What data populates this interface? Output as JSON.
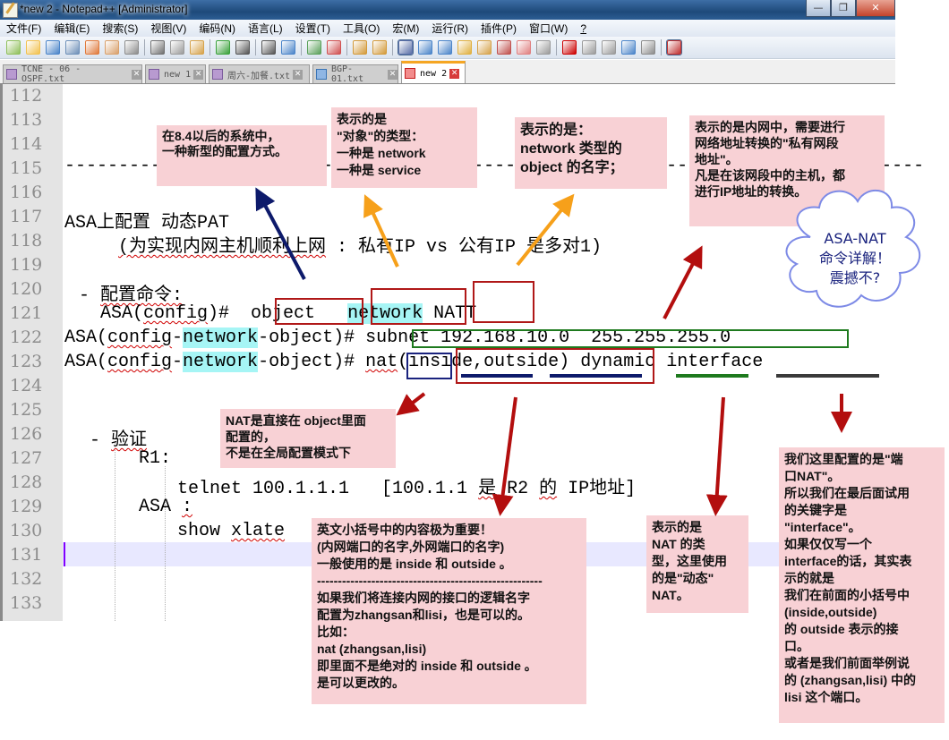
{
  "window": {
    "title": "*new 2 - Notepad++ [Administrator]",
    "buttons": {
      "minimize": "—",
      "restore": "❐",
      "close": "✕"
    }
  },
  "menubar": {
    "items": [
      "文件(F)",
      "编辑(E)",
      "搜索(S)",
      "视图(V)",
      "编码(N)",
      "语言(L)",
      "设置(T)",
      "工具(O)",
      "宏(M)",
      "运行(R)",
      "插件(P)",
      "窗口(W)",
      "?"
    ]
  },
  "toolbar": {
    "icons": [
      "new-file-icon",
      "open-file-icon",
      "save-icon",
      "save-all-icon",
      "close-icon",
      "close-all-icon",
      "print-icon",
      "sep",
      "cut-icon",
      "copy-icon",
      "paste-icon",
      "sep",
      "undo-icon",
      "redo-icon",
      "sep",
      "find-icon",
      "replace-icon",
      "sep",
      "zoom-in-icon",
      "zoom-out-icon",
      "sep",
      "sync-vertical-icon",
      "sync-horizontal-icon",
      "sep",
      "word-wrap-icon",
      "show-all-chars-icon",
      "indent-guide-icon",
      "user-defined-language-icon",
      "document-map-icon",
      "function-list-icon",
      "folder-workspace-icon",
      "monitoring-icon",
      "sep",
      "record-macro-icon",
      "stop-record-icon",
      "playback-macro-icon",
      "run-macro-multiple-icon",
      "save-macro-icon",
      "sep",
      "spell-check-icon"
    ]
  },
  "tabs": [
    {
      "label": "TCNE - 06 - OSPF.txt",
      "active": false
    },
    {
      "label": "new 1",
      "active": false
    },
    {
      "label": "周六-加餐.txt",
      "active": false
    },
    {
      "label": "BGP-01.txt",
      "active": false
    },
    {
      "label": "new 2",
      "active": true
    }
  ],
  "editor": {
    "line_numbers": [
      "112",
      "113",
      "114",
      "115",
      "116",
      "117",
      "118",
      "119",
      "120",
      "121",
      "122",
      "123",
      "124",
      "125",
      "126",
      "127",
      "128",
      "129",
      "130",
      "131",
      "132",
      "133"
    ],
    "current_line": "131",
    "lines": {
      "l115": "--------------------------------------------------------------------------------",
      "l117": "ASA上配置 动态PAT",
      "l118_a": "(为实现内网主机顺利上网",
      "l118_b": " : 私有IP vs 公有IP 是多对1)",
      "l120_dash": "- ",
      "l120_text": "配置命令:",
      "l121_prompt": "ASA(",
      "l121_config": "config",
      "l121_rest": ")#  ",
      "l121_object": "object",
      "l121_network": "network",
      "l121_name": "NATT",
      "l122_a": "ASA(",
      "l122_config": "config",
      "l122_dash": "-",
      "l122_network": "network",
      "l122_rest": "-object)# ",
      "l122_subnet": "subnet 192.168.10.0  255.255.255.0",
      "l123_a": "ASA(",
      "l123_config": "config",
      "l123_dash": "-",
      "l123_network": "network",
      "l123_rest": "-object)# ",
      "l123_nat": "nat",
      "l123_paren_open": "(",
      "l123_inside": "inside",
      "l123_comma": ",",
      "l123_outside": "outside",
      "l123_paren_close": ")",
      "l123_dynamic": "dynamic",
      "l123_interface": "interface",
      "l126_dash": "- ",
      "l126_text": "验证",
      "l127": "R1:",
      "l128_a": "telnet 100.1.1.1   [100.1.1 ",
      "l128_shi": "是",
      "l128_b": " R2 ",
      "l128_de": "的",
      "l128_c": " IP地址]",
      "l129_a": "ASA ",
      "l129_colon": ":",
      "l130_a": "show ",
      "l130_xlate": "xlate"
    }
  },
  "annotations": {
    "new_method": "在8.4以后的系统中，\n一种新型的配置方式。",
    "object_type": "表示的是\n\"对象\"的类型：\n一种是 network\n一种是 service",
    "object_name": "表示的是：\nnetwork 类型的\nobject 的名字；",
    "private_subnet": "表示的是内网中，需要进行\n网络地址转换的\"私有网段\n地址\"。\n凡是在该网段中的主机，都\n进行IP地址的转换。",
    "cloud": "ASA-NAT\n命令详解！\n震撼不?",
    "nat_in_object": "NAT是直接在 object里面\n配置的，\n不是在全局配置模式下",
    "parentheses": "英文小括号中的内容极为重要！\n(内网端口的名字,外网端口的名字)\n一般使用的是 inside 和 outside 。\n------------------------------------------------------\n如果我们将连接内网的接口的逻辑名字\n配置为zhangsan和lisi，也是可以的。\n比如：\nnat (zhangsan,lisi)\n即里面不是绝对的 inside 和 outside 。\n是可以更改的。",
    "nat_type": "表示的是\nNAT 的类\n型，这里使用\n的是\"动态\"\nNAT。",
    "port_nat": "我们这里配置的是\"端\n口NAT\"。\n所以我们在最后面试用\n的关键字是\n\"interface\"。\n如果仅仅写一个\ninterface的话，其实表\n示的就是\n我们在前面的小括号中\n(inside,outside)\n的 outside 表示的接\n口。\n或者是我们前面举例说\n的 (zhangsan,lisi) 中的\nlisi 这个端口。"
  },
  "colors": {
    "note_bg": "#f8d1d5",
    "box_red": "#b01818",
    "box_green": "#1e7a1e",
    "box_navy": "#1a237e",
    "arrow_navy": "#0d1a6b",
    "arrow_orange": "#f6a01a",
    "arrow_red": "#b30e0e",
    "highlight_cyan": "#a6f5f5"
  }
}
